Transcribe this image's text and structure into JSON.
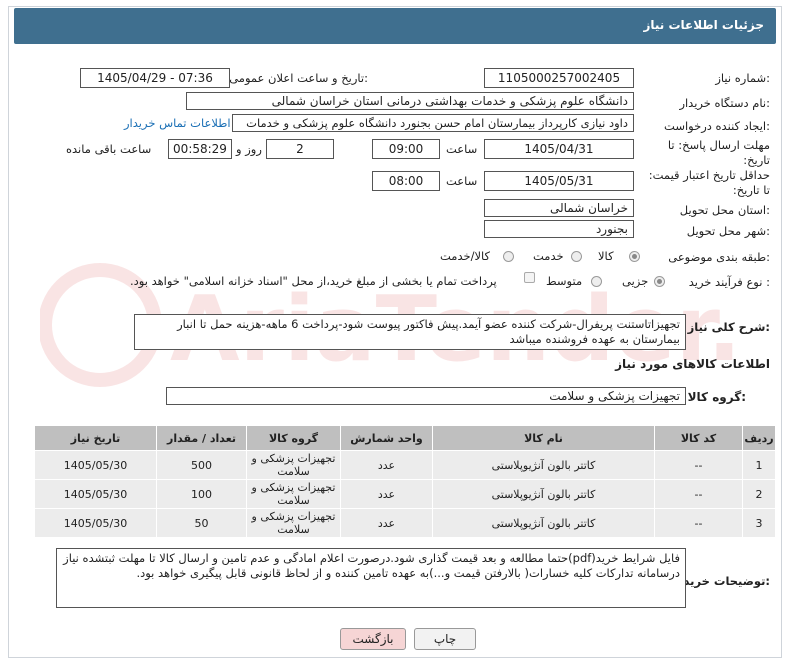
{
  "header": {
    "title": "جزئیات اطلاعات نیاز"
  },
  "fields": {
    "need_number_label": "شماره نیاز:",
    "need_number": "1105000257002405",
    "announce_label": "تاریخ و ساعت اعلان عمومی:",
    "announce_value": "1405/04/29 - 07:36",
    "buyer_org_label": "نام دستگاه خریدار:",
    "buyer_org": "دانشگاه علوم پزشکی و خدمات بهداشتی درمانی استان خراسان شمالی",
    "creator_label": "ایجاد کننده درخواست:",
    "creator": "داود نیازی کارپرداز بیمارستان امام حسن بجنورد دانشگاه علوم پزشکی و خدمات",
    "contact_link": "اطلاعات تماس خریدار",
    "reply_deadline_label": "مهلت ارسال پاسخ: تا تاریخ:",
    "reply_date": "1405/04/31",
    "time_label": "ساعت",
    "reply_time": "09:00",
    "days_value": "2",
    "days_label": "روز و",
    "remaining_time": "00:58:29",
    "remaining_label": "ساعت باقی مانده",
    "price_validity_label": "حداقل تاریخ اعتبار قیمت: تا تاریخ:",
    "price_date": "1405/05/31",
    "price_time_label": "ساعت",
    "price_time": "08:00",
    "province_label": "استان محل تحویل:",
    "province": "خراسان شمالی",
    "city_label": "شهر محل تحویل:",
    "city": "بجنورد",
    "category_label": "طبقه بندی موضوعی:",
    "cat_goods": "کالا",
    "cat_service": "خدمت",
    "cat_goods_service": "کالا/خدمت",
    "process_label": "نوع فرآیند خرید :",
    "proc_partial": "جزیی",
    "proc_medium": "متوسط",
    "treasury_note": "پرداخت تمام یا بخشی از مبلغ خرید،از محل \"اسناد خزانه اسلامی\" خواهد بود.",
    "description_label": "شرح کلی نیاز:",
    "description": "تجهیزاتاستنت پریفرال-شرکت کننده عضو آیمد.پیش فاکتور پیوست  شود-پرداخت 6 ماهه-هزینه حمل تا انبار بیمارستان به عهده فروشنده میباشد",
    "goods_info_title": "اطلاعات کالاهای مورد نیاز",
    "goods_group_label": "گروه کالا:",
    "goods_group": "تجهیزات پزشکی و سلامت",
    "buyer_notes_label": "توضیحات خریدار:",
    "buyer_notes": "فایل شرایط خرید(pdf)حتما مطالعه و بعد قیمت گذاری شود.درصورت اعلام امادگی و عدم تامین و ارسال کالا تا مهلت ثبتشده نیاز درسامانه تدارکات کلیه خسارات( بالارفتن قیمت و...)به عهده تامین کننده و از لحاظ قانونی قابل پیگیری خواهد بود."
  },
  "table": {
    "headers": [
      "ردیف",
      "کد کالا",
      "نام کالا",
      "واحد شمارش",
      "گروه کالا",
      "تعداد / مقدار",
      "تاریخ نیاز"
    ],
    "rows": [
      [
        "1",
        "--",
        "کاتتر بالون آنژیوپلاستی",
        "عدد",
        "تجهیزات پزشکی و سلامت",
        "500",
        "1405/05/30"
      ],
      [
        "2",
        "--",
        "کاتتر بالون آنژیوپلاستی",
        "عدد",
        "تجهیزات پزشکی و سلامت",
        "100",
        "1405/05/30"
      ],
      [
        "3",
        "--",
        "کاتتر بالون آنژیوپلاستی",
        "عدد",
        "تجهیزات پزشکی و سلامت",
        "50",
        "1405/05/30"
      ]
    ]
  },
  "buttons": {
    "print": "چاپ",
    "back": "بازگشت"
  },
  "watermark": "AriaTender.net",
  "colors": {
    "header": "#3f6f8f",
    "link": "#1a6fb5",
    "back_button": "#f6d5d5"
  }
}
